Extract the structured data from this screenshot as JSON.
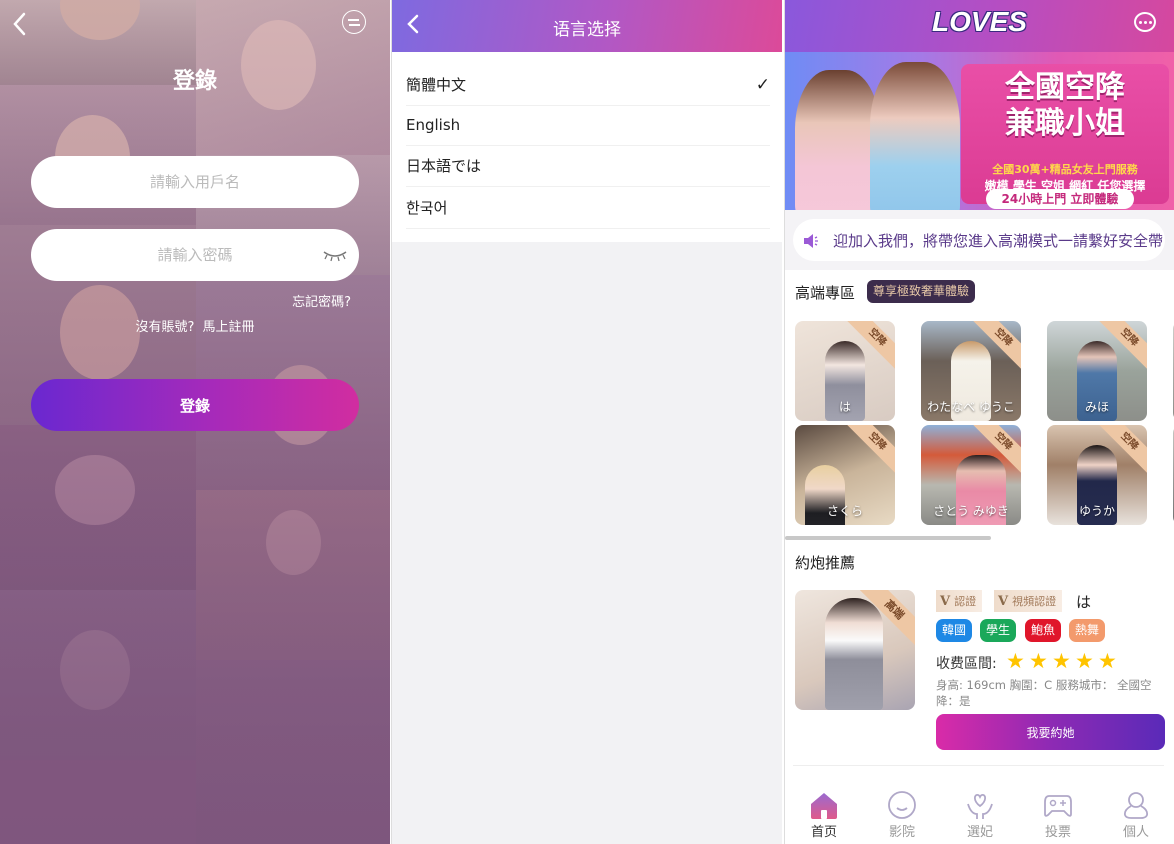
{
  "login": {
    "title": "登錄",
    "username_placeholder": "請輸入用戶名",
    "password_placeholder": "請輸入密碼",
    "forgot_password": "忘記密碼?",
    "no_account": "沒有賬號?",
    "register_now": "馬上註冊",
    "submit_label": "登錄",
    "icons": [
      "back-icon",
      "language-switch-icon",
      "eye-closed-icon"
    ]
  },
  "language": {
    "title": "语言选择",
    "options": [
      {
        "label": "簡體中文",
        "selected": true
      },
      {
        "label": "English",
        "selected": false
      },
      {
        "label": "日本語では",
        "selected": false
      },
      {
        "label": "한국어",
        "selected": false
      }
    ],
    "check_mark": "✓"
  },
  "home": {
    "logo": "LOVES",
    "banner": {
      "title_line1": "全國空降",
      "title_line2": "兼職小姐",
      "subtitle1": "全國30萬+精品女友上門服務",
      "subtitle2": "嫩模 學生 空姐 網紅 任您選擇",
      "pill": "24小時上門 立即體驗"
    },
    "notice": "迎加入我們，將帶您進入高潮模式一請繫好安全帶",
    "premium": {
      "title": "高端專區",
      "badge": "尊享極致奢華體驗",
      "cards": [
        {
          "name": "は",
          "ribbon": "空降"
        },
        {
          "name": "わたなべ ゆうこ",
          "ribbon": "空降"
        },
        {
          "name": "みほ",
          "ribbon": "空降"
        },
        {
          "name": "さくら",
          "ribbon": "空降"
        },
        {
          "name": "さとう みゆき",
          "ribbon": "空降"
        },
        {
          "name": "ゆうか",
          "ribbon": "空降"
        }
      ]
    },
    "recommend": {
      "title": "約炮推薦",
      "ribbon": "高端",
      "verify1": "認證",
      "verify2": "視頻認證",
      "name": "は",
      "tags": [
        {
          "label": "韓國",
          "color": "#1e88e5"
        },
        {
          "label": "學生",
          "color": "#1aa85a"
        },
        {
          "label": "鮑魚",
          "color": "#e0162b"
        },
        {
          "label": "熱舞",
          "color": "#f39a6c"
        }
      ],
      "price_label": "收费區間:",
      "rating": 5,
      "rating_max": 5,
      "info": "身高: 169cm 胸圍：C 服務城市： 全國空降：是",
      "button": "我要約她"
    },
    "tabs": [
      {
        "label": "首页",
        "icon": "home-icon",
        "active": true
      },
      {
        "label": "影院",
        "icon": "smile-icon",
        "active": false
      },
      {
        "label": "選妃",
        "icon": "heart-hand-icon",
        "active": false
      },
      {
        "label": "投票",
        "icon": "gamepad-icon",
        "active": false
      },
      {
        "label": "個人",
        "icon": "user-icon",
        "active": false
      }
    ]
  }
}
